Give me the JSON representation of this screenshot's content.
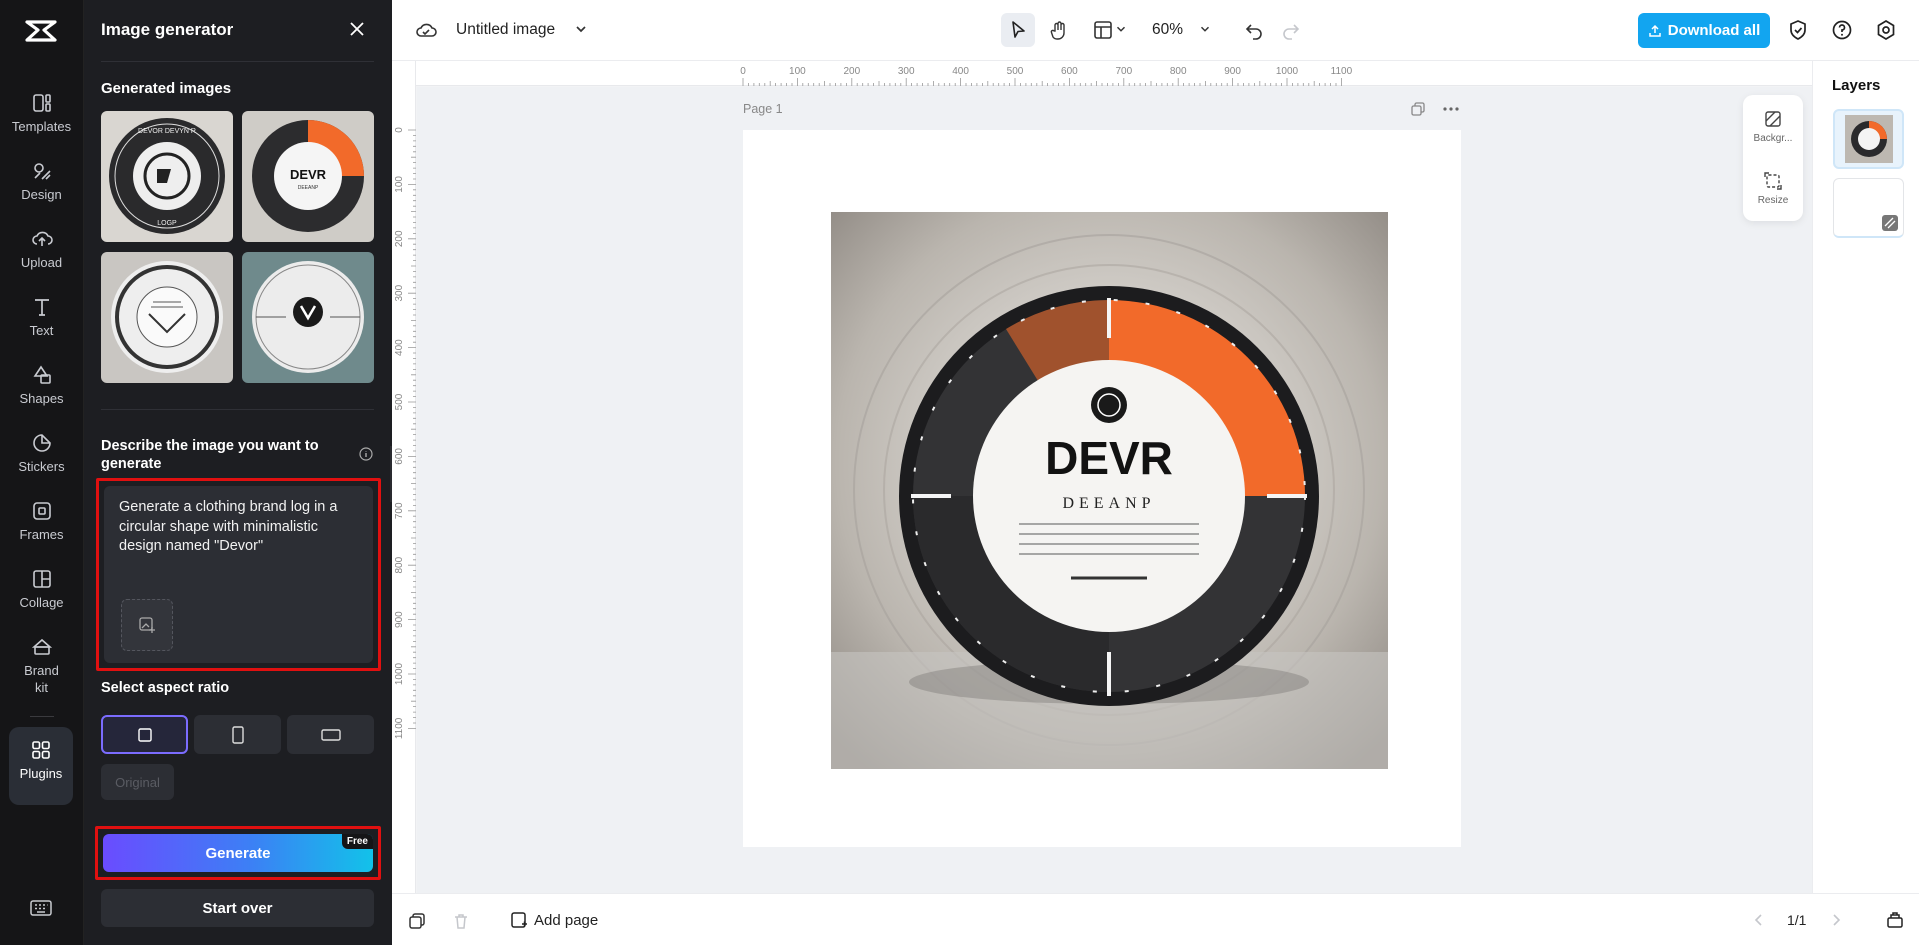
{
  "rail": {
    "items": [
      {
        "label": "Templates"
      },
      {
        "label": "Design"
      },
      {
        "label": "Upload"
      },
      {
        "label": "Text"
      },
      {
        "label": "Shapes"
      },
      {
        "label": "Stickers"
      },
      {
        "label": "Frames"
      },
      {
        "label": "Collage"
      },
      {
        "label": "Brand kit"
      },
      {
        "label": "Plugins"
      }
    ]
  },
  "panel": {
    "title": "Image generator",
    "generated_heading": "Generated images",
    "describe_heading": "Describe the image you want to generate",
    "prompt_value": "Generate a clothing brand log in a circular shape with minimalistic design named \"Devor\"",
    "aspect_heading": "Select aspect ratio",
    "original_label": "Original",
    "generate_label": "Generate",
    "free_badge": "Free",
    "start_over_label": "Start over"
  },
  "toolbar": {
    "title": "Untitled image",
    "zoom": "60%",
    "download_label": "Download all"
  },
  "canvas": {
    "page_label": "Page 1",
    "ruler_top": [
      "0",
      "100",
      "200",
      "300",
      "400",
      "500",
      "600",
      "700",
      "800",
      "900",
      "1000",
      "1100"
    ],
    "ruler_left": [
      "0",
      "100",
      "200",
      "300",
      "400",
      "500",
      "600",
      "700",
      "800",
      "900",
      "1000",
      "1100"
    ],
    "art_text_main": "DEVR",
    "art_text_sub": "DEEANP"
  },
  "float": {
    "background_label": "Backgr...",
    "resize_label": "Resize"
  },
  "layers": {
    "title": "Layers"
  },
  "bottom": {
    "add_page_label": "Add page",
    "page_count": "1/1"
  },
  "colors": {
    "accent": "#12a5f0",
    "highlight": "#e01010",
    "art_orange": "#f26a2a"
  }
}
